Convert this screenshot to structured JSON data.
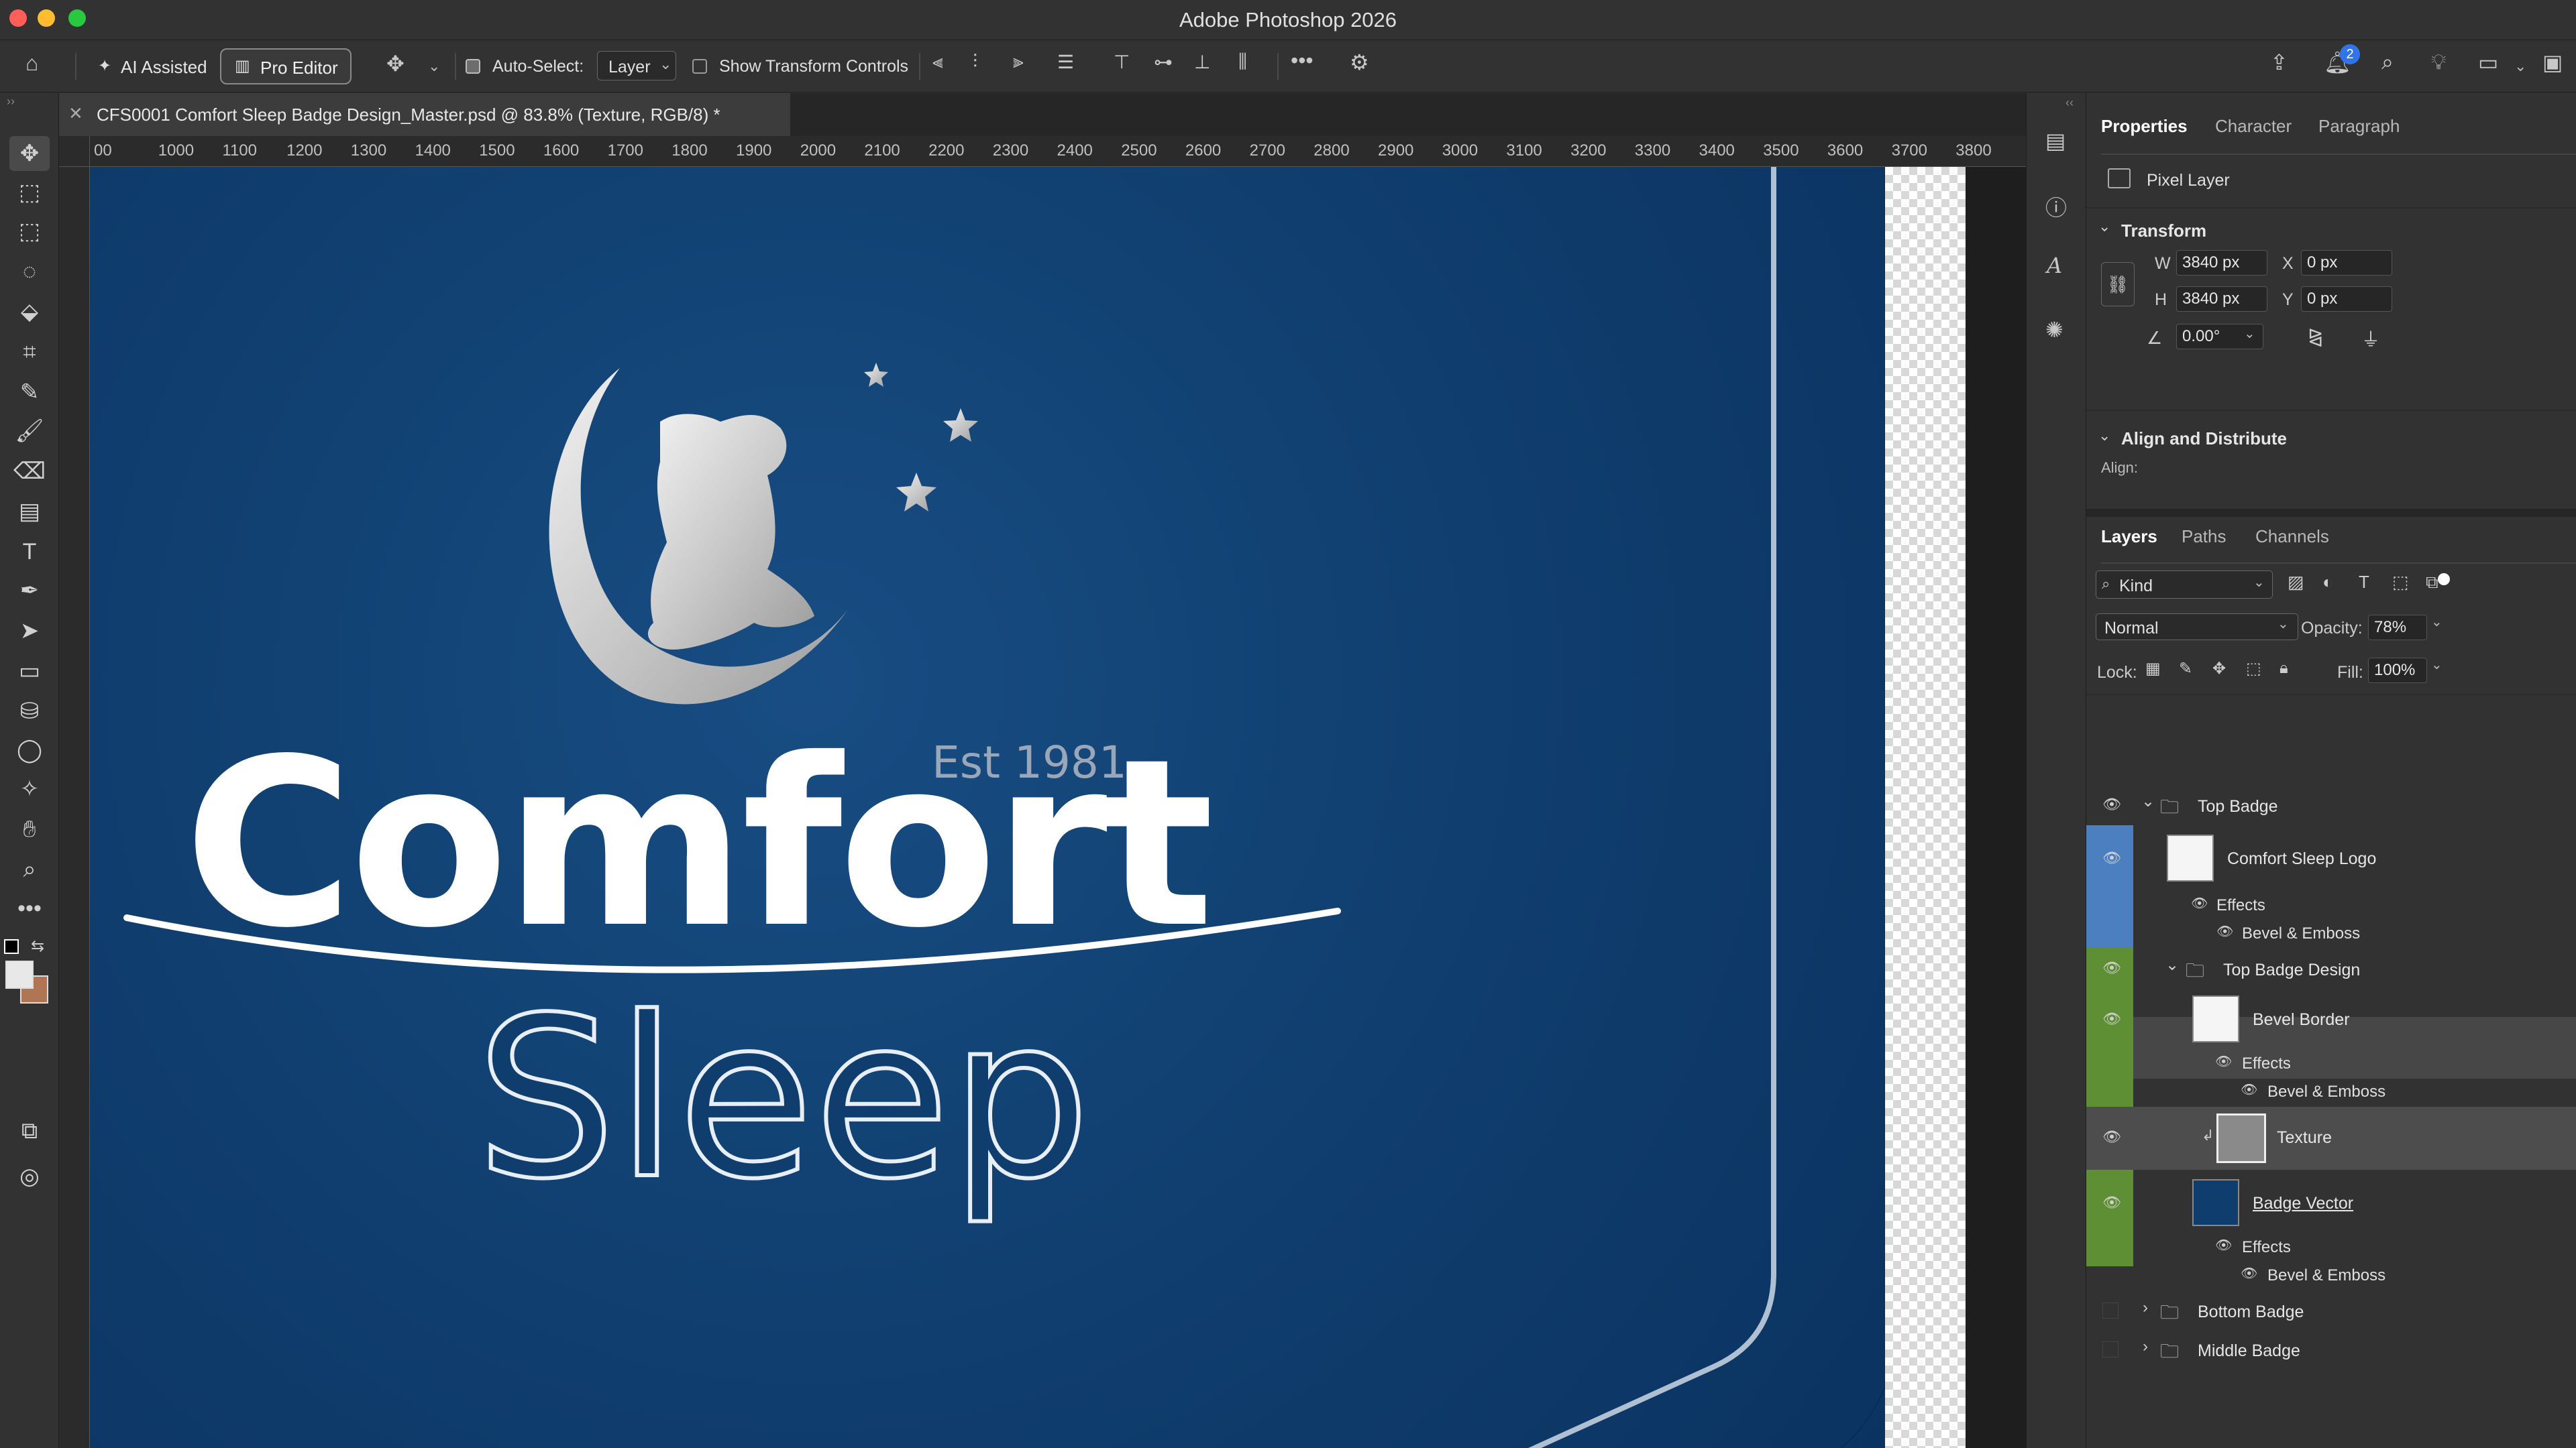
{
  "app": {
    "title": "Adobe Photoshop 2026"
  },
  "options_bar": {
    "ai_assisted": "AI Assisted",
    "pro_editor": "Pro Editor",
    "auto_select_label": "Auto-Select:",
    "auto_select_value": "Layer",
    "show_transform_controls": "Show Transform Controls",
    "notification_count": "2"
  },
  "document": {
    "tab_title": "CFS0001 Comfort Sleep Badge Design_Master.psd @ 83.8% (Texture, RGB/8) *"
  },
  "ruler": {
    "h_labels": [
      "00",
      "1000",
      "1100",
      "1200",
      "1300",
      "1400",
      "1500",
      "1600",
      "1700",
      "1800",
      "1900",
      "2000",
      "2100",
      "2200",
      "2300",
      "2400",
      "2500",
      "2600",
      "2700",
      "2800",
      "2900",
      "3000",
      "3100",
      "3200",
      "3300",
      "3400",
      "3500",
      "3600",
      "3700",
      "3800"
    ]
  },
  "canvas": {
    "est": "Est 1981",
    "brand_1": "Comfort",
    "brand_2": "Sleep"
  },
  "properties": {
    "tabs": [
      "Properties",
      "Character",
      "Paragraph"
    ],
    "layer_kind": "Pixel Layer",
    "transform_title": "Transform",
    "w_label": "W",
    "w_value": "3840 px",
    "h_label": "H",
    "h_value": "3840 px",
    "x_label": "X",
    "x_value": "0 px",
    "y_label": "Y",
    "y_value": "0 px",
    "angle_value": "0.00°",
    "align_title": "Align and Distribute",
    "align_label": "Align:"
  },
  "layers_panel": {
    "tabs": [
      "Layers",
      "Paths",
      "Channels"
    ],
    "filter_kind": "Kind",
    "blend_mode": "Normal",
    "opacity_label": "Opacity:",
    "opacity_value": "78%",
    "lock_label": "Lock:",
    "fill_label": "Fill:",
    "fill_value": "100%",
    "layers": [
      {
        "name": "Top Badge"
      },
      {
        "name": "Comfort Sleep Logo"
      },
      {
        "name": "Effects"
      },
      {
        "name": "Bevel & Emboss"
      },
      {
        "name": "Top Badge Design"
      },
      {
        "name": "Bevel Border"
      },
      {
        "name": "Effects"
      },
      {
        "name": "Bevel & Emboss"
      },
      {
        "name": "Texture"
      },
      {
        "name": "Badge Vector"
      },
      {
        "name": "Effects"
      },
      {
        "name": "Bevel & Emboss"
      },
      {
        "name": "Bottom Badge"
      },
      {
        "name": "Middle Badge"
      }
    ]
  },
  "colors": {
    "logo_highlight": "#4c7fbf",
    "green_group": "#5f8f34",
    "badge_blue": "#0f3d6d"
  }
}
